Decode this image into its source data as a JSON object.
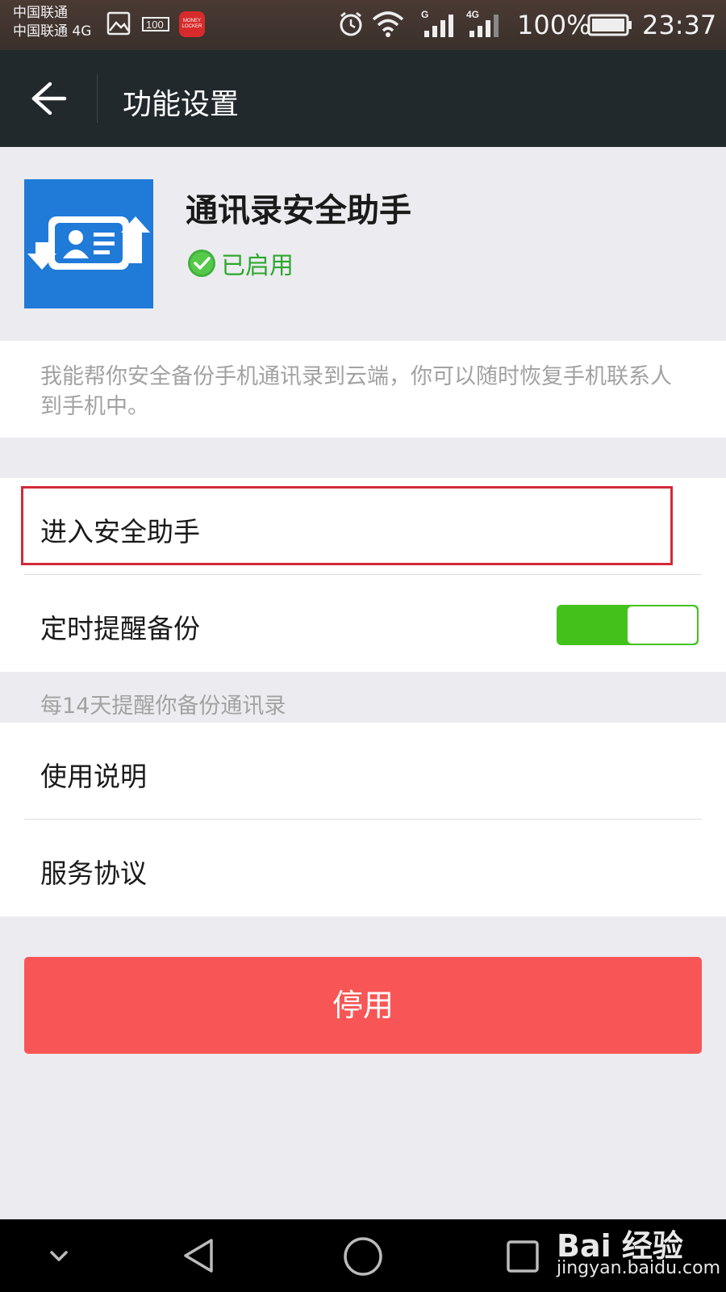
{
  "status_bar": {
    "carrier_line1": "中国联通",
    "carrier_line2": "中国联通 4G",
    "icons": [
      "image-notification-icon",
      "100-icon",
      "money-locker-icon",
      "alarm-icon",
      "wifi-icon",
      "signal-g-icon",
      "signal-4g-icon",
      "battery-icon"
    ],
    "signal_label_1": "G",
    "signal_label_2": "4G",
    "app_badge_text": "MONEY LOCKER",
    "battery": "100%",
    "time": "23:37"
  },
  "title_bar": {
    "back_icon": "arrow-left-icon",
    "title": "功能设置"
  },
  "feature": {
    "icon": "contacts-sync-icon",
    "name": "通讯录安全助手",
    "status_icon": "check-circle-icon",
    "status": "已启用",
    "description": "我能帮你安全备份手机通讯录到云端，你可以随时恢复手机联系人到手机中。"
  },
  "menu": {
    "enter_assistant": "进入安全助手",
    "scheduled_reminder": "定时提醒备份",
    "reminder_enabled": true,
    "reminder_tip": "每14天提醒你备份通讯录",
    "instructions": "使用说明",
    "service_agreement": "服务协议"
  },
  "disable_button": "停用",
  "nav_bar": {
    "icons": [
      "chevron-down-icon",
      "back-triangle-icon",
      "home-circle-icon",
      "recents-square-icon"
    ]
  },
  "watermark": {
    "main": "Bai 经验",
    "sub": "jingyan.baidu.com"
  },
  "colors": {
    "accent_green": "#44c21c",
    "danger_red": "#f85656",
    "title_bar_bg": "#22292c",
    "highlight_red": "#d22a3a"
  }
}
